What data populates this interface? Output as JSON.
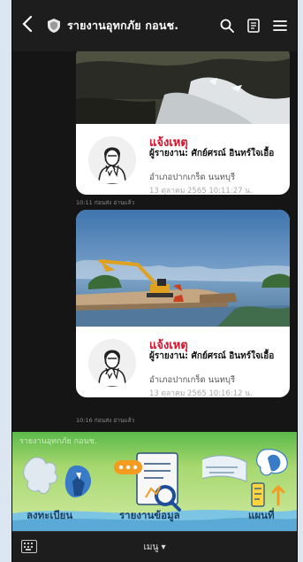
{
  "header": {
    "title": "รายงานอุทกภัย กอนช.",
    "back_icon": "chevron-left-icon",
    "search_icon": "search-icon",
    "notes_icon": "notes-icon",
    "menu_icon": "hamburger-menu-icon"
  },
  "messages": [
    {
      "alert": "แจ้งเหตุ",
      "reporter": "ผู้รายงาน: ศักย์ศรณ์ อินทร์ใจเอื้อ",
      "place": "อำเภอปากเกร็ด นนทบุรี",
      "stamp": "13 ตุลาคม 2565 10:11:27 น.",
      "meta": "10:11 ก่อนส่ง อ่านแล้ว"
    },
    {
      "alert": "แจ้งเหตุ",
      "reporter": "ผู้รายงาน: ศักย์ศรณ์ อินทร์ใจเอื้อ",
      "place": "อำเภอปากเกร็ด นนทบุรี",
      "stamp": "13 ตุลาคม 2565 10:16:12 น.",
      "meta": "10:16 ก่อนส่ง อ่านแล้ว"
    }
  ],
  "rich_menu": {
    "caption": "รายงานอุทกภัย กอนช.",
    "items": [
      {
        "label": "ลงทะเบียน",
        "icon": "register-map-icon"
      },
      {
        "label": "รายงานข้อมูล",
        "icon": "report-document-icon"
      },
      {
        "label": "แผนที่",
        "icon": "map-pin-icon"
      }
    ]
  },
  "bottom_bar": {
    "keyboard_icon": "keyboard-icon",
    "menu_label": "เมนู ▾"
  },
  "colors": {
    "alert": "#d0142c",
    "header_bg": "#1d1d1d",
    "chat_bg": "#151515",
    "menu_bg": "#5bb94a"
  }
}
